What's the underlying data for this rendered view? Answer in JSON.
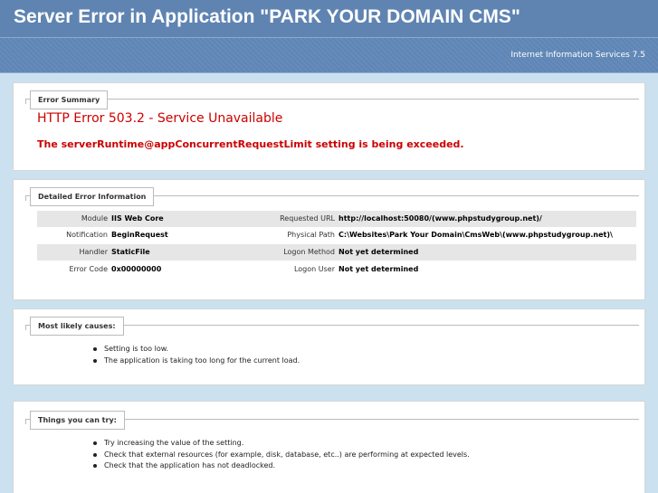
{
  "header": {
    "title": "Server Error in Application \"PARK YOUR DOMAIN CMS\""
  },
  "server": {
    "info": "Internet Information Services 7.5"
  },
  "summary": {
    "legend": "Error Summary",
    "error_title": "HTTP Error 503.2 - Service Unavailable",
    "error_desc": "The serverRuntime@appConcurrentRequestLimit setting is being exceeded."
  },
  "detail": {
    "legend": "Detailed Error Information",
    "rows": [
      {
        "left_label": "Module",
        "left_value": "IIS Web Core",
        "right_label": "Requested URL",
        "right_value": "http://localhost:50080/(www.phpstudygroup.net)/"
      },
      {
        "left_label": "Notification",
        "left_value": "BeginRequest",
        "right_label": "Physical Path",
        "right_value": "C:\\Websites\\Park Your Domain\\CmsWeb\\(www.phpstudygroup.net)\\"
      },
      {
        "left_label": "Handler",
        "left_value": "StaticFile",
        "right_label": "Logon Method",
        "right_value": "Not yet determined"
      },
      {
        "left_label": "Error Code",
        "left_value": "0x00000000",
        "right_label": "Logon User",
        "right_value": "Not yet determined"
      }
    ]
  },
  "causes": {
    "legend": "Most likely causes:",
    "items": [
      "Setting is too low.",
      "The application is taking too long for the current load."
    ]
  },
  "try": {
    "legend": "Things you can try:",
    "items": [
      "Try increasing the value of the setting.",
      "Check that external resources (for example, disk, database, etc..) are performing at expected levels.",
      "Check that the application has not deadlocked."
    ]
  }
}
